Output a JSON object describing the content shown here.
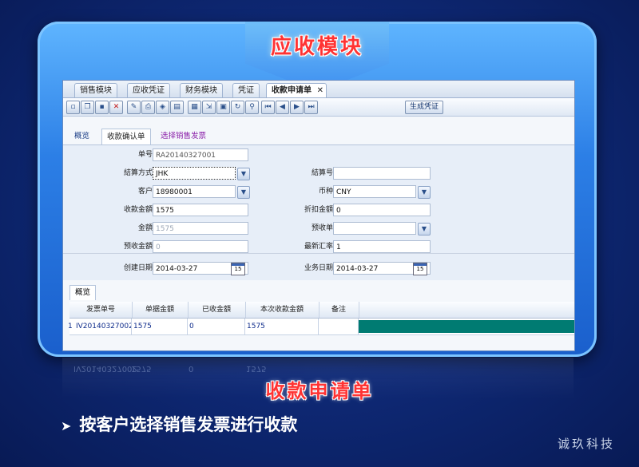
{
  "slide_title": "应收模块",
  "window": {
    "tabs": [
      "销售模块",
      "应收凭证",
      "财务模块",
      "凭证",
      "收款申请单"
    ],
    "close_glyph": "✕",
    "generate_button": "生成凭证",
    "subtabs": [
      "概览",
      "收款确认单",
      "选择销售发票"
    ],
    "form": {
      "order_no": {
        "label": "单号",
        "value": "RA20140327001"
      },
      "settle_method": {
        "label": "結算方式",
        "value": "JHK"
      },
      "settle_no": {
        "label": "結算号",
        "value": ""
      },
      "customer": {
        "label": "客户",
        "value": "18980001"
      },
      "currency": {
        "label": "币种",
        "value": "CNY"
      },
      "receipt_amount": {
        "label": "收款金額",
        "value": "1575"
      },
      "discount_amount": {
        "label": "折扣金額",
        "value": "0"
      },
      "amount": {
        "label": "金額",
        "value": "1575"
      },
      "prepay_no": {
        "label": "预收单",
        "value": ""
      },
      "prepay_amount": {
        "label": "预收金額",
        "value": "0"
      },
      "latest_rate": {
        "label": "最新汇率",
        "value": "1"
      },
      "create_date": {
        "label": "创建日期",
        "value": "2014-03-27"
      },
      "business_date": {
        "label": "业务日期",
        "value": "2014-03-27"
      },
      "calendar_day": "15"
    },
    "grid": {
      "tab": "概览",
      "columns": [
        "发票单号",
        "单据金額",
        "已收金額",
        "本次收款金額",
        "备注"
      ],
      "rows": [
        {
          "num": "1",
          "invoice_no": "IV20140327002",
          "doc_amount": "1575",
          "received": "0",
          "this_amount": "1575",
          "note": ""
        }
      ]
    }
  },
  "caption": "收款申请单",
  "bullet": "按客户选择销售发票进行收款",
  "bullet_marker": "➤",
  "brand": "诚玖科技",
  "colors": {
    "accent_red": "#ff3333",
    "teal": "#007b72",
    "background": "#0f2a78"
  }
}
